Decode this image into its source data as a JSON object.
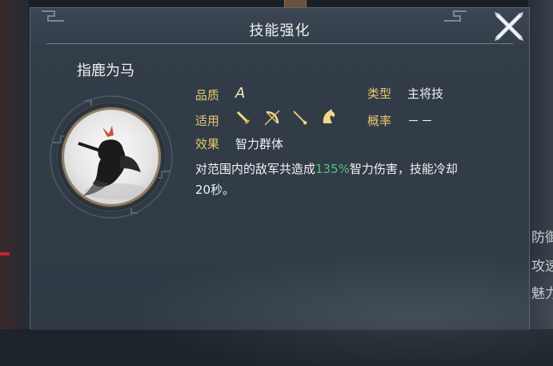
{
  "dialog": {
    "title": "技能强化"
  },
  "skill": {
    "name": "指鹿为马",
    "quality_label": "品质",
    "quality_value": "A",
    "type_label": "类型",
    "type_value": "主将技",
    "applicable_label": "适用",
    "applicable_units": [
      "sword-icon",
      "bow-icon",
      "spear-icon",
      "horse-icon"
    ],
    "chance_label": "概率",
    "chance_value": "－－",
    "effect_label": "效果",
    "effect_value": "智力群体",
    "desc_before": "对范围内的敌军共造成",
    "desc_highlight": "135%",
    "desc_after": "智力伤害，技能冷却",
    "desc_line2": "20秒。"
  },
  "background": {
    "side_texts": [
      "防御",
      "攻速",
      "魅力"
    ]
  },
  "colors": {
    "label": "#e7c76f",
    "highlight": "#59c07a",
    "panel": "#33404c"
  }
}
